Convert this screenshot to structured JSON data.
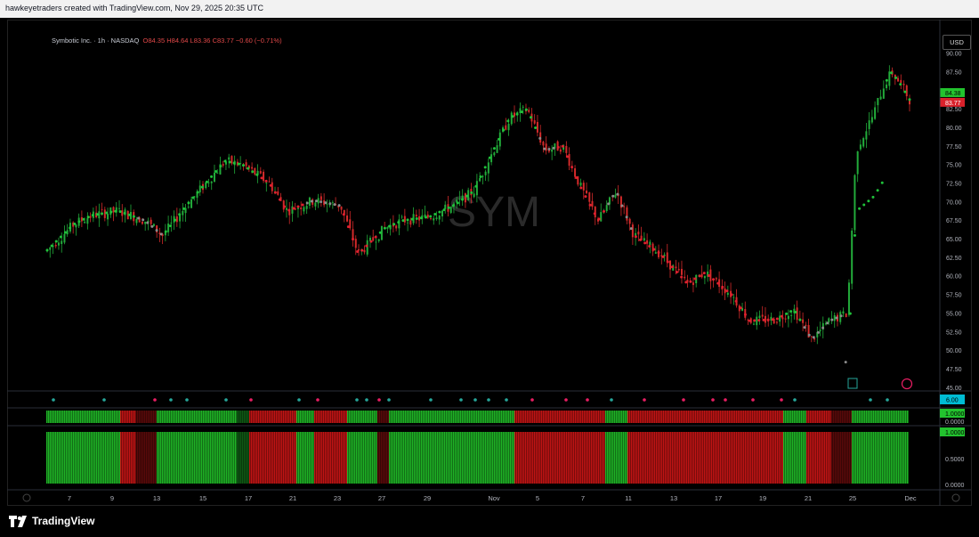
{
  "header": {
    "attribution": "hawkeyetraders created with TradingView.com, Nov 29, 2025 20:35 UTC"
  },
  "legend": {
    "symbol": "Symbotic Inc. · 1h · NASDAQ",
    "open": "O84.35",
    "high": "H84.64",
    "low": "L83.36",
    "close": "C83.77",
    "change": "−0.60 (−0.71%)"
  },
  "currency_button": "USD",
  "watermark": "SYM",
  "footer": {
    "brand": "TradingView"
  },
  "colors": {
    "up": "#22ab3a",
    "down": "#d42a2a",
    "neutral": "#8a8a8a",
    "background": "#000000"
  },
  "chart_data": [
    {
      "type": "candlestick",
      "title": "Symbotic Inc. · 1h · NASDAQ",
      "ylim": [
        45,
        91
      ],
      "y_ticks": [
        "90.00",
        "87.50",
        "85.00",
        "82.50",
        "80.00",
        "77.50",
        "75.00",
        "72.50",
        "70.00",
        "67.50",
        "65.00",
        "62.50",
        "60.00",
        "57.50",
        "55.00",
        "52.50",
        "50.00",
        "47.50",
        "45.00"
      ],
      "x_ticks": [
        "7",
        "9",
        "13",
        "15",
        "17",
        "21",
        "23",
        "27",
        "29",
        "Nov",
        "5",
        "7",
        "11",
        "13",
        "17",
        "19",
        "21",
        "25",
        "Dec"
      ],
      "price_labels": {
        "previous": "84.38",
        "last": "83.77"
      },
      "anchors": [
        {
          "t": 0,
          "p": 63.5
        },
        {
          "t": 3,
          "p": 67
        },
        {
          "t": 5,
          "p": 68.2
        },
        {
          "t": 8,
          "p": 68.8
        },
        {
          "t": 11,
          "p": 67.5
        },
        {
          "t": 13,
          "p": 65.5
        },
        {
          "t": 16,
          "p": 70
        },
        {
          "t": 20,
          "p": 75.5
        },
        {
          "t": 22,
          "p": 75
        },
        {
          "t": 25,
          "p": 72.5
        },
        {
          "t": 27,
          "p": 68.8
        },
        {
          "t": 30,
          "p": 70.2
        },
        {
          "t": 33,
          "p": 69.5
        },
        {
          "t": 35,
          "p": 63
        },
        {
          "t": 38,
          "p": 66.5
        },
        {
          "t": 40,
          "p": 67.5
        },
        {
          "t": 43,
          "p": 68
        },
        {
          "t": 46,
          "p": 69.7
        },
        {
          "t": 48,
          "p": 71.5
        },
        {
          "t": 50,
          "p": 76.5
        },
        {
          "t": 52,
          "p": 81.3
        },
        {
          "t": 54,
          "p": 82.5
        },
        {
          "t": 56,
          "p": 77
        },
        {
          "t": 58,
          "p": 77.5
        },
        {
          "t": 60,
          "p": 72
        },
        {
          "t": 62,
          "p": 67.5
        },
        {
          "t": 64,
          "p": 71.5
        },
        {
          "t": 66,
          "p": 65.5
        },
        {
          "t": 69,
          "p": 63
        },
        {
          "t": 72,
          "p": 59
        },
        {
          "t": 74,
          "p": 60.5
        },
        {
          "t": 77,
          "p": 57.5
        },
        {
          "t": 79,
          "p": 54
        },
        {
          "t": 82,
          "p": 54.2
        },
        {
          "t": 84,
          "p": 55.5
        },
        {
          "t": 86,
          "p": 51.5
        },
        {
          "t": 88,
          "p": 54
        },
        {
          "t": 90,
          "p": 55
        },
        {
          "t": 91,
          "p": 77
        },
        {
          "t": 93,
          "p": 82
        },
        {
          "t": 94,
          "p": 85.5
        },
        {
          "t": 95,
          "p": 87.5
        },
        {
          "t": 96,
          "p": 85.8
        },
        {
          "t": 97,
          "p": 83.8
        }
      ],
      "trail_states": [
        {
          "from": 0,
          "to": 10,
          "state": "up"
        },
        {
          "from": 10,
          "to": 13,
          "state": "neutral"
        },
        {
          "from": 13,
          "to": 24,
          "state": "up"
        },
        {
          "from": 24,
          "to": 29,
          "state": "down"
        },
        {
          "from": 29,
          "to": 33,
          "state": "neutral"
        },
        {
          "from": 33,
          "to": 37,
          "state": "down"
        },
        {
          "from": 37,
          "to": 55,
          "state": "up"
        },
        {
          "from": 55,
          "to": 57,
          "state": "neutral"
        },
        {
          "from": 57,
          "to": 63,
          "state": "down"
        },
        {
          "from": 63,
          "to": 66,
          "state": "neutral"
        },
        {
          "from": 66,
          "to": 83,
          "state": "down"
        },
        {
          "from": 83,
          "to": 85,
          "state": "up"
        },
        {
          "from": 85,
          "to": 90,
          "state": "neutral"
        },
        {
          "from": 90,
          "to": 97,
          "state": "up"
        }
      ]
    },
    {
      "type": "dots",
      "label": "6.00",
      "dots": [
        {
          "x": 60,
          "c": "teal"
        },
        {
          "x": 117,
          "c": "teal"
        },
        {
          "x": 174,
          "c": "pink"
        },
        {
          "x": 192,
          "c": "teal"
        },
        {
          "x": 210,
          "c": "teal"
        },
        {
          "x": 254,
          "c": "teal"
        },
        {
          "x": 282,
          "c": "pink"
        },
        {
          "x": 336,
          "c": "teal"
        },
        {
          "x": 357,
          "c": "pink"
        },
        {
          "x": 401,
          "c": "teal"
        },
        {
          "x": 412,
          "c": "teal"
        },
        {
          "x": 426,
          "c": "pink"
        },
        {
          "x": 437,
          "c": "teal"
        },
        {
          "x": 484,
          "c": "teal"
        },
        {
          "x": 518,
          "c": "teal"
        },
        {
          "x": 534,
          "c": "teal"
        },
        {
          "x": 549,
          "c": "teal"
        },
        {
          "x": 569,
          "c": "teal"
        },
        {
          "x": 598,
          "c": "pink"
        },
        {
          "x": 636,
          "c": "pink"
        },
        {
          "x": 660,
          "c": "pink"
        },
        {
          "x": 687,
          "c": "teal"
        },
        {
          "x": 724,
          "c": "pink"
        },
        {
          "x": 768,
          "c": "pink"
        },
        {
          "x": 801,
          "c": "pink"
        },
        {
          "x": 815,
          "c": "pink"
        },
        {
          "x": 846,
          "c": "pink"
        },
        {
          "x": 878,
          "c": "pink"
        },
        {
          "x": 893,
          "c": "teal"
        },
        {
          "x": 978,
          "c": "teal"
        },
        {
          "x": 997,
          "c": "teal"
        }
      ]
    },
    {
      "type": "heatmap",
      "label_top": "1.0000",
      "label_bottom": "0.0000",
      "segments": [
        {
          "from": 52,
          "to": 135,
          "c": "green"
        },
        {
          "from": 135,
          "to": 152,
          "c": "red"
        },
        {
          "from": 152,
          "to": 176,
          "c": "darkred"
        },
        {
          "from": 176,
          "to": 266,
          "c": "green"
        },
        {
          "from": 266,
          "to": 280,
          "c": "darkgreen"
        },
        {
          "from": 280,
          "to": 333,
          "c": "red"
        },
        {
          "from": 333,
          "to": 353,
          "c": "green"
        },
        {
          "from": 353,
          "to": 390,
          "c": "red"
        },
        {
          "from": 390,
          "to": 424,
          "c": "green"
        },
        {
          "from": 424,
          "to": 437,
          "c": "darkred"
        },
        {
          "from": 437,
          "to": 578,
          "c": "green"
        },
        {
          "from": 578,
          "to": 680,
          "c": "red"
        },
        {
          "from": 680,
          "to": 705,
          "c": "green"
        },
        {
          "from": 705,
          "to": 880,
          "c": "red"
        },
        {
          "from": 880,
          "to": 906,
          "c": "green"
        },
        {
          "from": 906,
          "to": 934,
          "c": "red"
        },
        {
          "from": 934,
          "to": 957,
          "c": "darkred"
        },
        {
          "from": 957,
          "to": 1021,
          "c": "green"
        }
      ]
    },
    {
      "type": "bar",
      "y_ticks": [
        "1.0000",
        "0.5000",
        "0.0000"
      ],
      "ylim": [
        0,
        1
      ],
      "segments": [
        {
          "from": 52,
          "to": 135,
          "c": "green"
        },
        {
          "from": 135,
          "to": 152,
          "c": "red"
        },
        {
          "from": 152,
          "to": 176,
          "c": "darkred"
        },
        {
          "from": 176,
          "to": 266,
          "c": "green"
        },
        {
          "from": 266,
          "to": 280,
          "c": "darkgreen"
        },
        {
          "from": 280,
          "to": 333,
          "c": "red"
        },
        {
          "from": 333,
          "to": 353,
          "c": "green"
        },
        {
          "from": 353,
          "to": 390,
          "c": "red"
        },
        {
          "from": 390,
          "to": 424,
          "c": "green"
        },
        {
          "from": 424,
          "to": 437,
          "c": "darkred"
        },
        {
          "from": 437,
          "to": 578,
          "c": "green"
        },
        {
          "from": 578,
          "to": 680,
          "c": "red"
        },
        {
          "from": 680,
          "to": 705,
          "c": "green"
        },
        {
          "from": 705,
          "to": 880,
          "c": "red"
        },
        {
          "from": 880,
          "to": 906,
          "c": "green"
        },
        {
          "from": 906,
          "to": 934,
          "c": "red"
        },
        {
          "from": 934,
          "to": 957,
          "c": "darkred"
        },
        {
          "from": 957,
          "to": 1021,
          "c": "green"
        }
      ]
    }
  ]
}
